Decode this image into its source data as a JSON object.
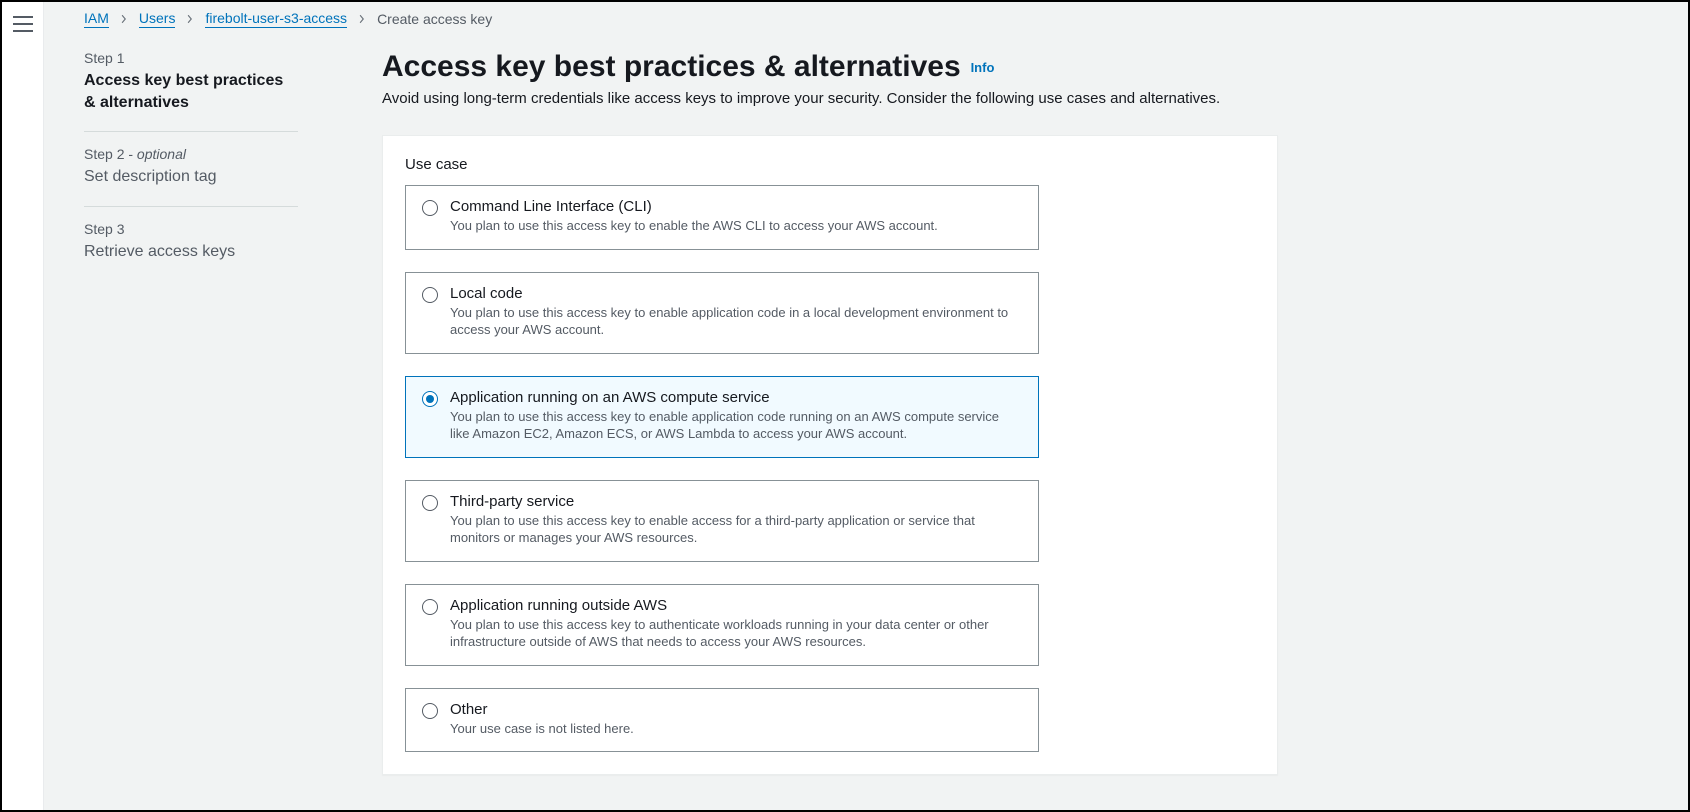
{
  "breadcrumb": {
    "items": [
      {
        "label": "IAM",
        "link": true
      },
      {
        "label": "Users",
        "link": true
      },
      {
        "label": "firebolt-user-s3-access",
        "link": true
      },
      {
        "label": "Create access key",
        "link": false
      }
    ]
  },
  "steps": [
    {
      "num": "Step 1",
      "optional": "",
      "title": "Access key best practices & alternatives",
      "active": true
    },
    {
      "num": "Step 2 - ",
      "optional": "optional",
      "title": "Set description tag",
      "active": false
    },
    {
      "num": "Step 3",
      "optional": "",
      "title": "Retrieve access keys",
      "active": false
    }
  ],
  "page": {
    "title": "Access key best practices & alternatives",
    "info": "Info",
    "desc": "Avoid using long-term credentials like access keys to improve your security. Consider the following use cases and alternatives."
  },
  "panel": {
    "label": "Use case"
  },
  "options": [
    {
      "title": "Command Line Interface (CLI)",
      "desc": "You plan to use this access key to enable the AWS CLI to access your AWS account.",
      "selected": false
    },
    {
      "title": "Local code",
      "desc": "You plan to use this access key to enable application code in a local development environment to access your AWS account.",
      "selected": false
    },
    {
      "title": "Application running on an AWS compute service",
      "desc": "You plan to use this access key to enable application code running on an AWS compute service like Amazon EC2, Amazon ECS, or AWS Lambda to access your AWS account.",
      "selected": true
    },
    {
      "title": "Third-party service",
      "desc": "You plan to use this access key to enable access for a third-party application or service that monitors or manages your AWS resources.",
      "selected": false
    },
    {
      "title": "Application running outside AWS",
      "desc": "You plan to use this access key to authenticate workloads running in your data center or other infrastructure outside of AWS that needs to access your AWS resources.",
      "selected": false
    },
    {
      "title": "Other",
      "desc": "Your use case is not listed here.",
      "selected": false
    }
  ]
}
